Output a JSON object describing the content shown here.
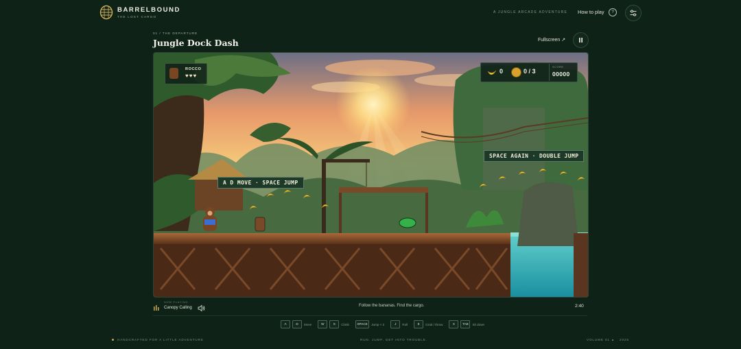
{
  "brand": {
    "name": "BARRELBOUND",
    "subtitle": "THE LOST CARGO"
  },
  "header": {
    "tagline": "A JUNGLE ARCADE ADVENTURE",
    "how_to_play": "How to play",
    "help_glyph": "?"
  },
  "level": {
    "act": "01 / THE DEPARTURE",
    "title": "Jungle Dock Dash",
    "fullscreen_label": "Fullscreen ↗"
  },
  "hud": {
    "player_name": "ROCCO",
    "lives_display": "♥♥♥",
    "lives": 3,
    "bananas": "0",
    "cargo": "0 / 3",
    "score_label": "SCORE",
    "score": "00000"
  },
  "hints": {
    "move": "A D  MOVE  ·  SPACE  JUMP",
    "double_jump": "SPACE AGAIN  ·  DOUBLE JUMP"
  },
  "now_playing": {
    "label": "NOW PLAYING",
    "track": "Canopy Calling"
  },
  "objective": "Follow the bananas. Find the cargo.",
  "timer": "2:40",
  "controls": [
    {
      "keys": [
        "A",
        "D"
      ],
      "label": "Move"
    },
    {
      "keys": [
        "W",
        "S"
      ],
      "label": "Climb"
    },
    {
      "keys": [
        "SPACE"
      ],
      "label": "Jump × 2"
    },
    {
      "keys": [
        "J"
      ],
      "label": "Roll"
    },
    {
      "keys": [
        "E"
      ],
      "label": "Grab / throw"
    },
    {
      "keys": [
        "X",
        "TAB"
      ],
      "label": "Sit down"
    }
  ],
  "footer": {
    "left": "HANDCRAFTED FOR A LITTLE ADVENTURE",
    "center": "RUN. JUMP. GET INTO TROUBLE.",
    "right": "VOLUME 01",
    "year": "2026"
  },
  "colors": {
    "background": "#0f2218",
    "accent": "#c9a64a",
    "water": "#2fb3b4",
    "hint_bg": "#1d3a29"
  }
}
